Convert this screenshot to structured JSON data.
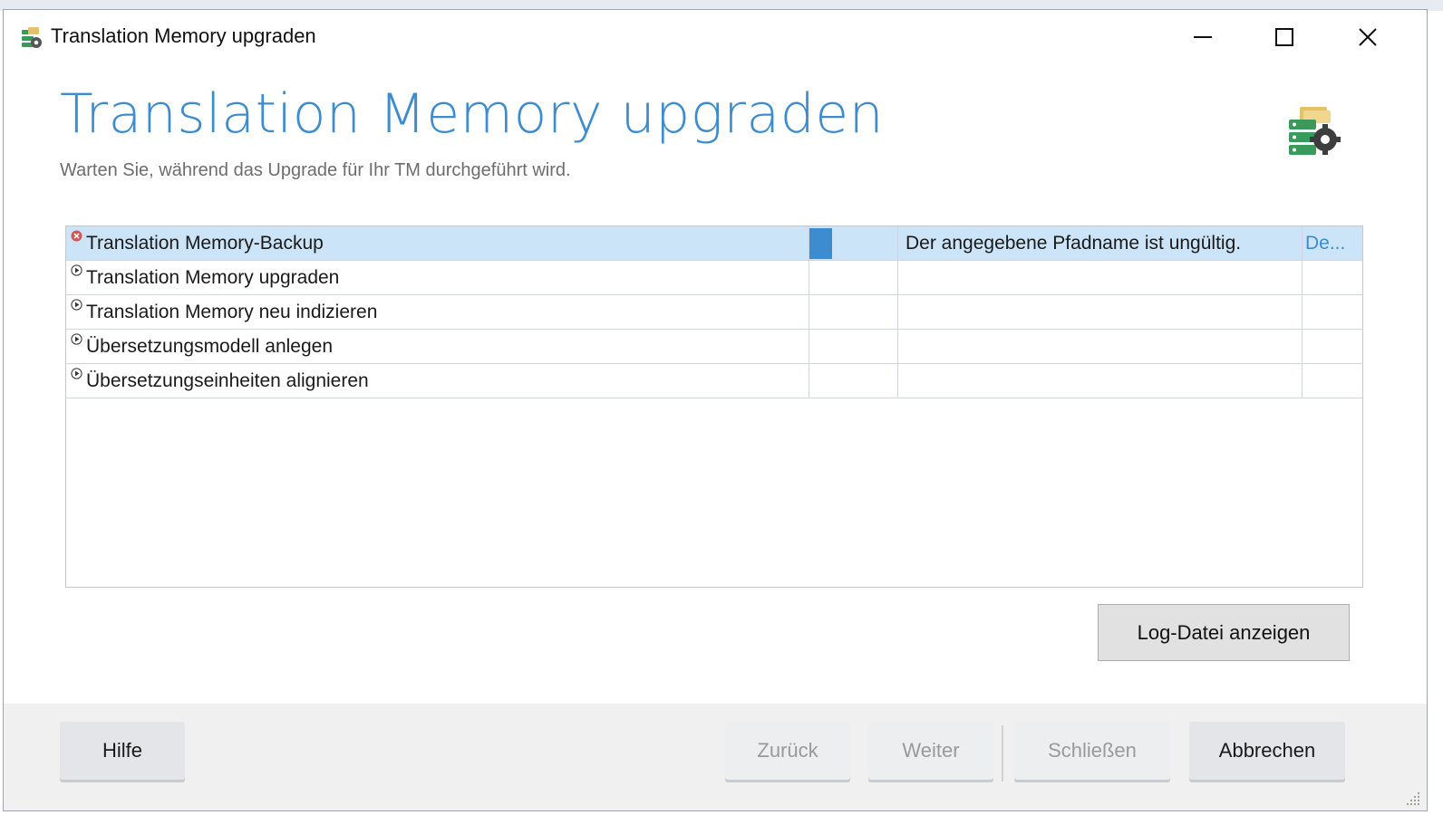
{
  "window": {
    "title": "Translation Memory upgraden",
    "controls": {
      "minimize": "minimize-icon",
      "maximize": "maximize-icon",
      "close": "close-icon"
    }
  },
  "header": {
    "title": "Translation Memory upgraden",
    "subtitle": "Warten Sie, während das Upgrade für Ihr TM durchgeführt wird."
  },
  "tasks": [
    {
      "name": "Translation Memory-Backup",
      "status": "error",
      "status_icon": "error-icon",
      "progress": 0.25,
      "message": "Der angegebene Pfadname ist ungültig.",
      "details": "De..."
    },
    {
      "name": "Translation Memory upgraden",
      "status": "pending",
      "status_icon": "play-icon",
      "progress": 0,
      "message": "",
      "details": ""
    },
    {
      "name": "Translation Memory neu indizieren",
      "status": "pending",
      "status_icon": "play-icon",
      "progress": 0,
      "message": "",
      "details": ""
    },
    {
      "name": "Übersetzungsmodell anlegen",
      "status": "pending",
      "status_icon": "play-icon",
      "progress": 0,
      "message": "",
      "details": ""
    },
    {
      "name": "Übersetzungseinheiten alignieren",
      "status": "pending",
      "status_icon": "play-icon",
      "progress": 0,
      "message": "",
      "details": ""
    }
  ],
  "buttons": {
    "log": "Log-Datei anzeigen",
    "help": "Hilfe",
    "back": "Zurück",
    "next": "Weiter",
    "finish": "Schließen",
    "cancel": "Abbrechen"
  },
  "colors": {
    "accent": "#3d8ccf",
    "selected_row": "#cce4f7",
    "error": "#d9534f"
  }
}
